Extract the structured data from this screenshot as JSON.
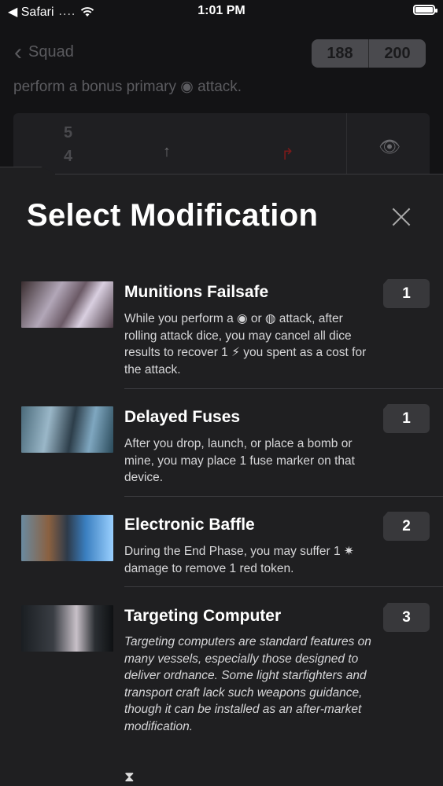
{
  "status_bar": {
    "back_app": "◀ Safari",
    "signal": "....",
    "time": "1:01 PM"
  },
  "background": {
    "back_label": "Squad",
    "points_current": "188",
    "points_max": "200",
    "ability_text": "perform a bonus primary ◉ attack.",
    "card_numbers": [
      "5",
      "4"
    ]
  },
  "sheet": {
    "title": "Select Modification",
    "items": [
      {
        "title": "Munitions Failsafe",
        "desc": "While you perform a ◉ or ◍ attack, after rolling attack dice, you may cancel all dice results to recover 1 ⚡ you spent as a cost for the attack.",
        "cost": "1",
        "italic": false
      },
      {
        "title": "Delayed Fuses",
        "desc": "After you drop, launch, or place a bomb or mine, you may place 1 fuse marker on that device.",
        "cost": "1",
        "italic": false
      },
      {
        "title": "Electronic Baffle",
        "desc": "During the End Phase, you may suffer 1 ✷ damage to remove 1 red token.",
        "cost": "2",
        "italic": false
      },
      {
        "title": "Targeting Computer",
        "desc": "Targeting computers are standard features on many vessels, especially those designed to deliver ordnance. Some light starfighters and transport craft lack such weapons guidance, though it can be installed as an after-market modification.",
        "cost": "3",
        "italic": true
      }
    ],
    "bottom_glyph": "⧗"
  }
}
